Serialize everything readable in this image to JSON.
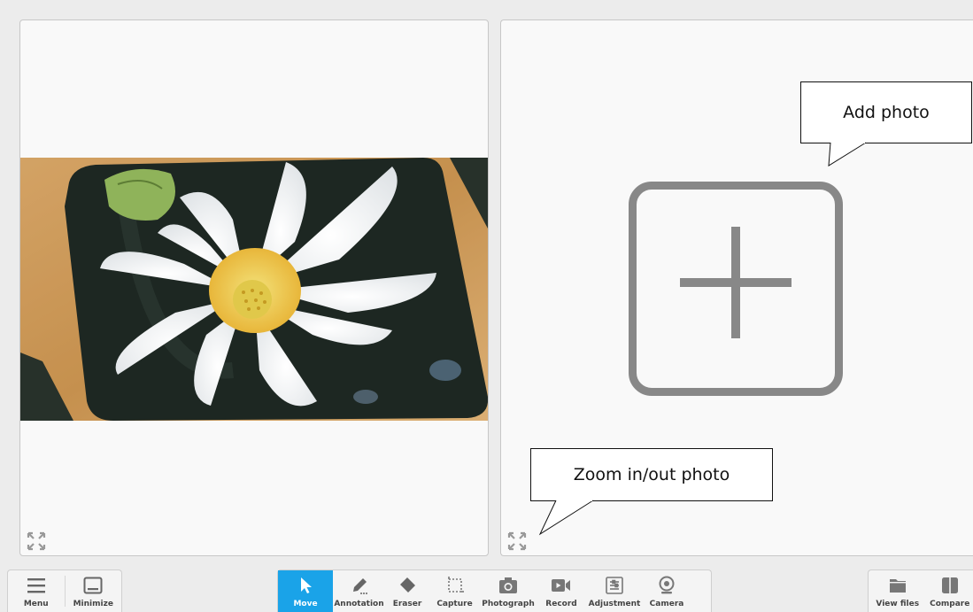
{
  "left_pane": {
    "expand_icon": "expand-arrows-icon",
    "photo": "white lotus flower on a dark tray with wooden edge"
  },
  "right_pane": {
    "add_icon": "add-photo-plus-icon",
    "expand_icon": "expand-arrows-icon"
  },
  "callouts": {
    "add_photo": "Add photo",
    "zoom": "Zoom in/out photo"
  },
  "toolbar": {
    "left": [
      {
        "label": "Menu",
        "icon": "hamburger-menu-icon"
      },
      {
        "label": "Minimize",
        "icon": "minimize-window-icon"
      }
    ],
    "center": [
      {
        "label": "Move",
        "icon": "cursor-arrow-icon",
        "active": true
      },
      {
        "label": "Annotation",
        "icon": "pencil-icon"
      },
      {
        "label": "Eraser",
        "icon": "eraser-icon"
      },
      {
        "label": "Capture",
        "icon": "crop-capture-icon"
      },
      {
        "label": "Photograph",
        "icon": "photo-camera-icon"
      },
      {
        "label": "Record",
        "icon": "video-record-icon"
      },
      {
        "label": "Adjustment",
        "icon": "sliders-adjust-icon"
      },
      {
        "label": "Camera",
        "icon": "webcam-icon"
      }
    ],
    "right": [
      {
        "label": "View files",
        "icon": "folder-icon"
      },
      {
        "label": "Compare",
        "icon": "compare-split-icon"
      }
    ]
  },
  "colors": {
    "active": "#1aa3e8",
    "icon": "#888888",
    "pane_bg": "#f9f9f9",
    "app_bg": "#ececec"
  }
}
